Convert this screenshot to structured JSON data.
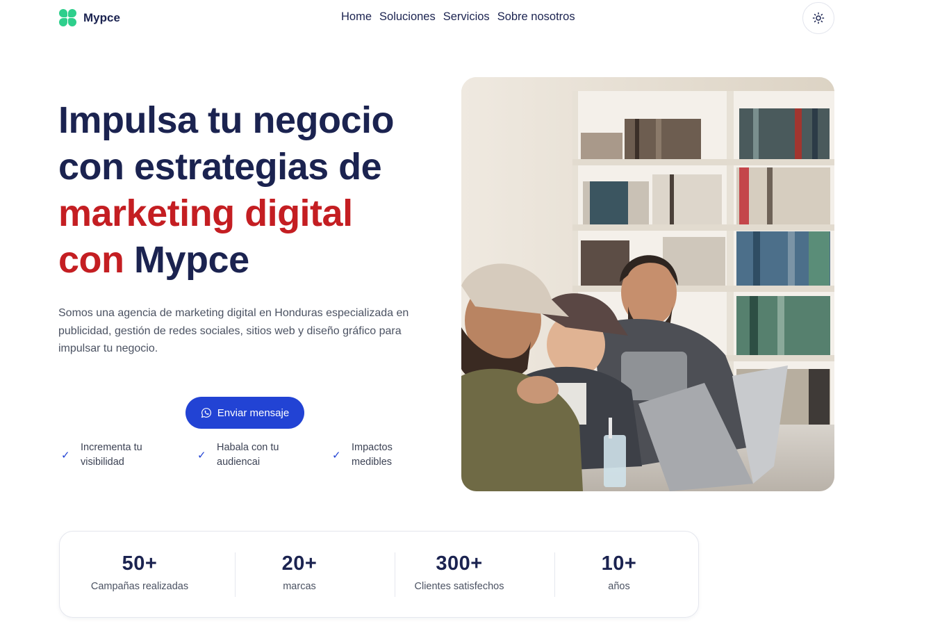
{
  "nav": {
    "brand": "Mypce",
    "menu": [
      "Home",
      "Soluciones",
      "Servicios",
      "Sobre nosotros"
    ],
    "theme_icon": "sun-icon"
  },
  "hero": {
    "title_line1": "Impulsa tu negocio",
    "title_line2": "con estrategias de",
    "title_line3_accent": "marketing digital",
    "title_line4_accent": "con",
    "title_line4_rest": "Mypce",
    "description": "Somos una agencia de marketing digital en Honduras especializada en publicidad, gestión de redes sociales, sitios web y diseño gráfico para impulsar tu negocio.",
    "cta_label": "Enviar mensaje",
    "cta_icon": "whatsapp-icon",
    "features": [
      {
        "label": "Incrementa tu visibilidad"
      },
      {
        "label": "Habala con tu audiencai"
      },
      {
        "label": "Impactos medibles"
      }
    ]
  },
  "stats": [
    {
      "value": "50+",
      "label": "Campañas realizadas"
    },
    {
      "value": "20+",
      "label": "marcas"
    },
    {
      "value": "300+",
      "label": "Clientes satisfechos"
    },
    {
      "value": "10+",
      "label": "años"
    }
  ],
  "colors": {
    "navy": "#1b2350",
    "accent_red": "#c41e22",
    "button_blue": "#2243d4",
    "logo_green": "#2ecf8c"
  }
}
